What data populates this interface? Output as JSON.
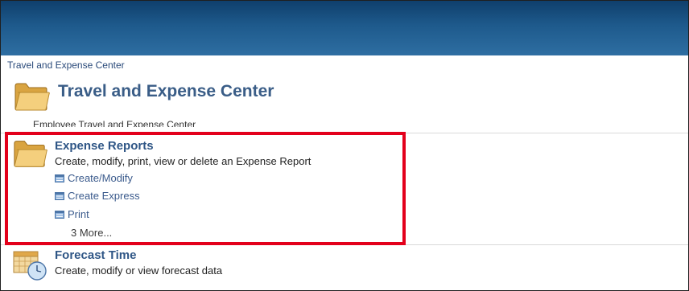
{
  "breadcrumb": "Travel and Expense Center",
  "page": {
    "title": "Travel and Expense Center",
    "subtitle": "Employee Travel and Expense Center"
  },
  "sections": {
    "expense_reports": {
      "title": "Expense Reports",
      "description": "Create, modify, print, view or delete an Expense Report",
      "links": [
        "Create/Modify",
        "Create Express",
        "Print"
      ],
      "more": "3 More..."
    },
    "forecast_time": {
      "title": "Forecast Time",
      "description": "Create, modify or view forecast data"
    }
  },
  "colors": {
    "header": "#1e5a8c",
    "highlight": "#e3001b",
    "link": "#3a5a8c",
    "title": "#3a5d87"
  },
  "icons": {
    "folder": "folder-icon",
    "link": "component-icon",
    "calendar": "calendar-clock-icon"
  }
}
